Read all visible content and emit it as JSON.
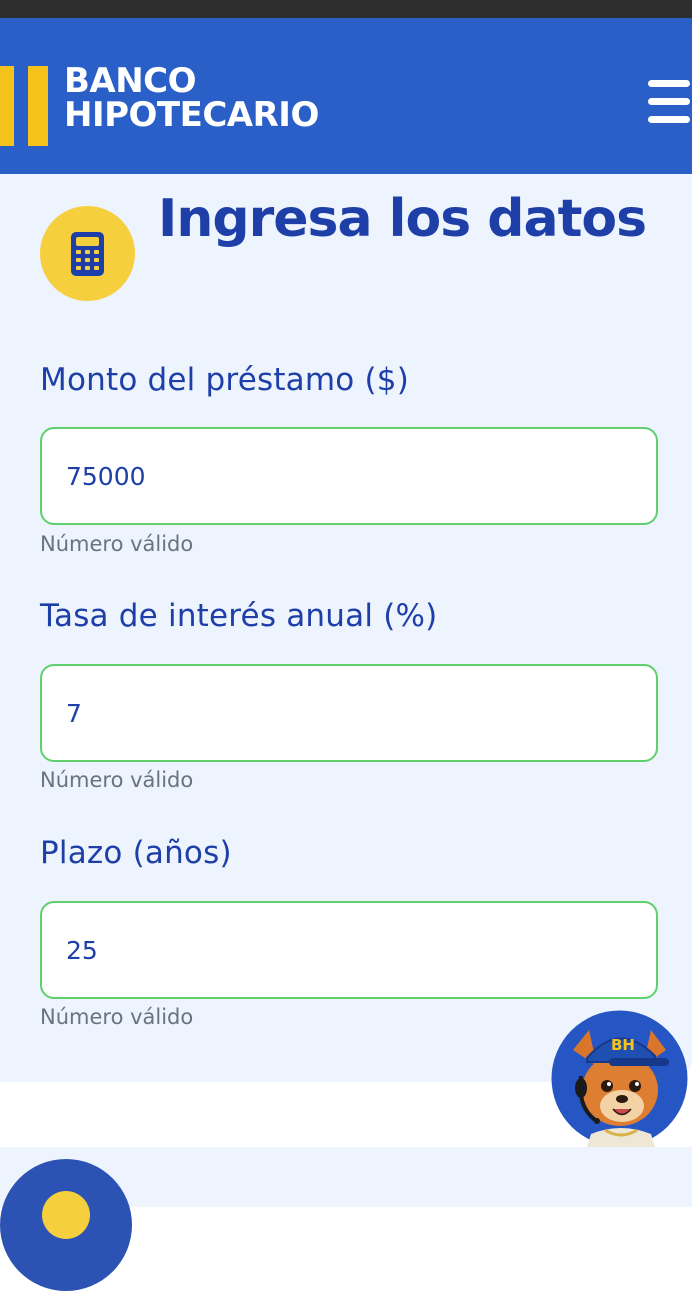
{
  "header": {
    "brand_line1": "BANCO",
    "brand_line2": "HIPOTECARIO",
    "brand_color": "#2a5fc8",
    "accent_color": "#f5c31c",
    "menu_icon": "hamburger-menu-icon"
  },
  "form": {
    "title": "Ingresa los datos",
    "title_icon": "calculator-icon",
    "fields": [
      {
        "label": "Monto del préstamo ($)",
        "value": "75000",
        "help": "Número válido"
      },
      {
        "label": "Tasa de interés anual (%)",
        "value": "7",
        "help": "Número válido"
      },
      {
        "label": "Plazo (años)",
        "value": "25",
        "help": "Número válido"
      }
    ],
    "valid_border_color": "#5fd06b"
  },
  "assistant": {
    "icon": "mascot-avatar-icon",
    "cap_text": "BH"
  }
}
